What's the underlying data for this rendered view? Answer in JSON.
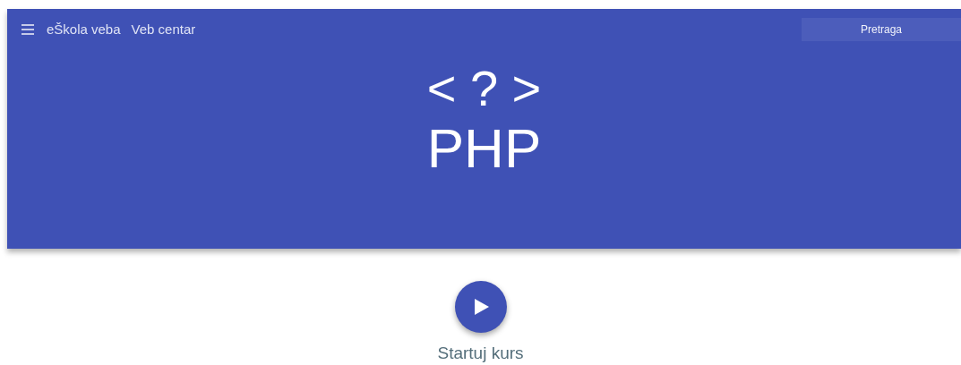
{
  "header": {
    "brand": "eŠkola veba",
    "link": "Veb centar",
    "search": {
      "placeholder": "Pretraga"
    }
  },
  "hero": {
    "symbol": "< ? >",
    "title": "PHP"
  },
  "start": {
    "label": "Startuj kurs"
  }
}
